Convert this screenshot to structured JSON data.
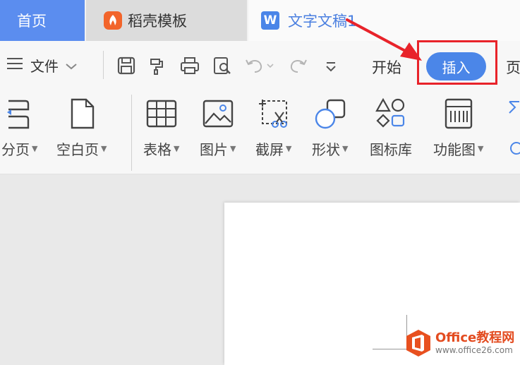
{
  "tabs": {
    "home": "首页",
    "template": "稻壳模板",
    "document": "文字文稿1",
    "doc_logo": "W"
  },
  "toolbar": {
    "file_menu": "文件",
    "icons": [
      "menu-icon",
      "chevron-down-icon",
      "save-icon",
      "format-painter-icon",
      "print-icon",
      "print-preview-icon",
      "undo-icon",
      "redo-icon",
      "more-icon"
    ],
    "tab_start": "开始",
    "tab_insert": "插入",
    "tab_page_partial": "页"
  },
  "ribbon": {
    "items": [
      {
        "label": "分页",
        "icon": "page-break-icon",
        "dropdown": true
      },
      {
        "label": "空白页",
        "icon": "blank-page-icon",
        "dropdown": true
      },
      {
        "label": "表格",
        "icon": "table-icon",
        "dropdown": true
      },
      {
        "label": "图片",
        "icon": "picture-icon",
        "dropdown": true
      },
      {
        "label": "截屏",
        "icon": "screenshot-icon",
        "dropdown": true
      },
      {
        "label": "形状",
        "icon": "shapes-icon",
        "dropdown": true
      },
      {
        "label": "图标库",
        "icon": "icon-library-icon",
        "dropdown": false
      },
      {
        "label": "功能图",
        "icon": "function-chart-icon",
        "dropdown": true
      }
    ]
  },
  "watermark": {
    "brand": "Office教程网",
    "url": "www.office26.com"
  },
  "colors": {
    "home_tab": "#5b8def",
    "accent_blue": "#4b86e8",
    "highlight_red": "#e8232a",
    "watermark_orange": "#e34b1f"
  }
}
